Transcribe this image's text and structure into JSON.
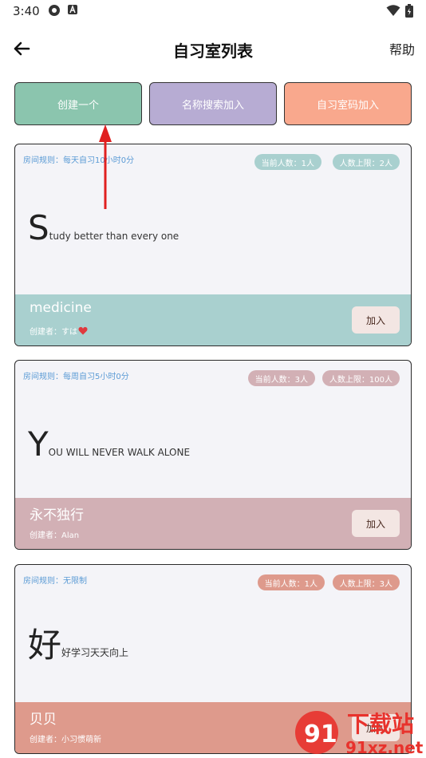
{
  "status_bar": {
    "time": "3:40"
  },
  "header": {
    "title": "自习室列表",
    "help_label": "帮助"
  },
  "actions": [
    {
      "label": "创建一个",
      "color": "#8bc5ae"
    },
    {
      "label": "名称搜索加入",
      "color": "#b7acd3"
    },
    {
      "label": "自习室码加入",
      "color": "#f9a88d"
    }
  ],
  "rooms": [
    {
      "rule": "房间规则：每天自习10小时0分",
      "current": "当前人数：1人",
      "limit": "人数上限：2人",
      "motto_first": "S",
      "motto_rest": "tudy better than every one",
      "name": "medicine",
      "creator": "创建者：すは",
      "join_label": "加入",
      "color": "#a9d0cf",
      "pill_color": "#a9d0cf"
    },
    {
      "rule": "房间规则：每周自习5小时0分",
      "current": "当前人数：3人",
      "limit": "人数上限：100人",
      "motto_first": "Y",
      "motto_rest": "OU WILL NEVER WALK ALONE",
      "name": "永不独行",
      "creator": "创建者：Alan",
      "join_label": "加入",
      "color": "#d2b0b5",
      "pill_color": "#d2b0b5"
    },
    {
      "rule": "房间规则：无限制",
      "current": "当前人数：1人",
      "limit": "人数上限：3人",
      "motto_first": "好",
      "motto_rest": "好学习天天向上",
      "name": "贝贝",
      "creator": "创建者：小习惯萌新",
      "join_label": "加入",
      "color": "#de9a8c",
      "pill_color": "#de9a8c"
    }
  ],
  "watermark": {
    "text": "下载站",
    "url_text": "91xz.net"
  }
}
